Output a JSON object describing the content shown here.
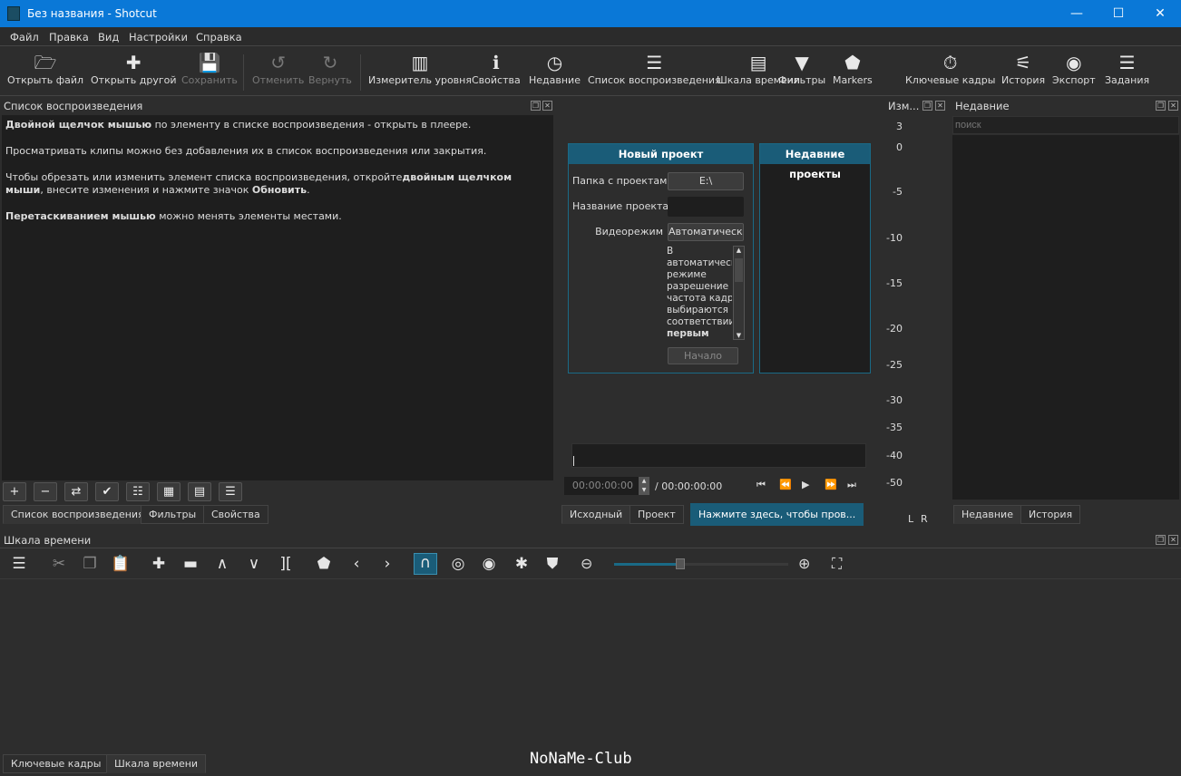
{
  "window": {
    "title": "Без названия - Shotcut",
    "minimize": "—",
    "maximize": "☐",
    "close": "✕"
  },
  "menu": [
    "Файл",
    "Правка",
    "Вид",
    "Настройки",
    "Справка"
  ],
  "toolbar": [
    {
      "label": "Открыть файл",
      "icon": "folder-icon",
      "glyph": "🗁",
      "enabled": true
    },
    {
      "label": "Открыть другой",
      "icon": "open-other-icon",
      "glyph": "✚",
      "enabled": true
    },
    {
      "label": "Сохранить",
      "icon": "save-icon",
      "glyph": "💾",
      "enabled": false
    },
    {
      "label": "Отменить",
      "icon": "undo-icon",
      "glyph": "↺",
      "enabled": false
    },
    {
      "label": "Вернуть",
      "icon": "redo-icon",
      "glyph": "↻",
      "enabled": false
    },
    {
      "label": "Измеритель уровня",
      "icon": "audio-meter-icon",
      "glyph": "▥",
      "enabled": true
    },
    {
      "label": "Свойства",
      "icon": "info-icon",
      "glyph": "ℹ",
      "enabled": true
    },
    {
      "label": "Недавние",
      "icon": "clock-icon",
      "glyph": "◷",
      "enabled": true
    },
    {
      "label": "Список воспроизведения",
      "icon": "list-icon",
      "glyph": "☰",
      "enabled": true
    },
    {
      "label": "Шкала времени",
      "icon": "timeline-icon",
      "glyph": "▤",
      "enabled": true
    },
    {
      "label": "Фильтры",
      "icon": "filter-icon",
      "glyph": "▼",
      "enabled": true
    },
    {
      "label": "Markers",
      "icon": "marker-icon",
      "glyph": "⬟",
      "enabled": true
    },
    {
      "label": "Ключевые кадры",
      "icon": "stopwatch-icon",
      "glyph": "⏱",
      "enabled": true
    },
    {
      "label": "История",
      "icon": "history-icon",
      "glyph": "⚟",
      "enabled": true
    },
    {
      "label": "Экспорт",
      "icon": "export-icon",
      "glyph": "◉",
      "enabled": true
    },
    {
      "label": "Задания",
      "icon": "jobs-icon",
      "glyph": "☰",
      "enabled": true
    }
  ],
  "playlist": {
    "title": "Список воспроизведения",
    "help": [
      {
        "bold": "Двойной щелчок мышью",
        "text": " по элементу в списке воспроизведения - открыть в плеере."
      },
      {
        "bold": "",
        "text": "Просматривать клипы можно без добавления их в список воспроизведения или закрытия."
      },
      {
        "text1": "Чтобы обрезать или изменить элемент списка воспроизведения, откройте",
        "bold": "двойным щелчком мыши",
        "text2": ", внесите изменения и нажмите значок ",
        "bold2": "Обновить",
        "text3": "."
      },
      {
        "bold": "Перетаскиванием мышью",
        "text": " можно менять элементы местами."
      }
    ],
    "buttons": [
      "+",
      "−",
      "⇄",
      "✔",
      "☷",
      "▦",
      "▤",
      "☰"
    ],
    "tabs": [
      "Список воспроизведения",
      "Фильтры",
      "Свойства"
    ]
  },
  "player": {
    "new_project": {
      "title": "Новый проект",
      "folder_label": "Папка с проектами",
      "folder_value": "E:\\",
      "name_label": "Название проекта",
      "name_value": "",
      "mode_label": "Видеорежим",
      "mode_value": "Автоматически",
      "description": [
        "В",
        "автоматическом",
        "режиме",
        "разрешение и",
        "частота кадров",
        "выбираются в",
        "соответствии"
      ],
      "description_bold": "первым",
      "start_button": "Начало"
    },
    "recent_projects": {
      "title": "Недавние проекты"
    },
    "timecode": "00:00:00:00",
    "duration": "/ 00:00:00:00",
    "transport": [
      "⏮",
      "⏪",
      "▶",
      "⏩",
      "⏭"
    ],
    "tabs": [
      "Исходный",
      "Проект",
      "Нажмите здесь, чтобы пров..."
    ]
  },
  "meter": {
    "title": "Изм...",
    "scale": [
      "3",
      "0",
      "-5",
      "-10",
      "-15",
      "-20",
      "-25",
      "-30",
      "-35",
      "-40",
      "-50"
    ],
    "channels": [
      "L",
      "R"
    ]
  },
  "recent": {
    "title": "Недавние",
    "search_placeholder": "поиск",
    "tabs": [
      "Недавние",
      "История"
    ]
  },
  "timeline": {
    "title": "Шкала времени",
    "tools": [
      {
        "icon": "menu-icon",
        "glyph": "☰"
      },
      {
        "icon": "cut-icon",
        "glyph": "✂"
      },
      {
        "icon": "copy-icon",
        "glyph": "❐"
      },
      {
        "icon": "paste-icon",
        "glyph": "📋"
      },
      {
        "icon": "append-icon",
        "glyph": "✚"
      },
      {
        "icon": "remove-icon",
        "glyph": "▬"
      },
      {
        "icon": "lift-icon",
        "glyph": "∧"
      },
      {
        "icon": "overwrite-icon",
        "glyph": "∨"
      },
      {
        "icon": "split-icon",
        "glyph": "]["
      },
      {
        "icon": "marker-icon",
        "glyph": "⬟"
      },
      {
        "icon": "prev-marker-icon",
        "glyph": "‹"
      },
      {
        "icon": "next-marker-icon",
        "glyph": "›"
      },
      {
        "icon": "snap-icon",
        "glyph": "∩"
      },
      {
        "icon": "scrub-icon",
        "glyph": "◎"
      },
      {
        "icon": "ripple-icon",
        "glyph": "◉"
      },
      {
        "icon": "ripple-all-icon",
        "glyph": "✱"
      },
      {
        "icon": "ripple-markers-icon",
        "glyph": "⛊"
      }
    ],
    "zoom_level": 0.38,
    "tabs": [
      "Ключевые кадры",
      "Шкала времени"
    ]
  },
  "watermark": "NoNaMe-Club",
  "colors": {
    "accent": "#1a5c78",
    "titlebar": "#0a78d7"
  }
}
